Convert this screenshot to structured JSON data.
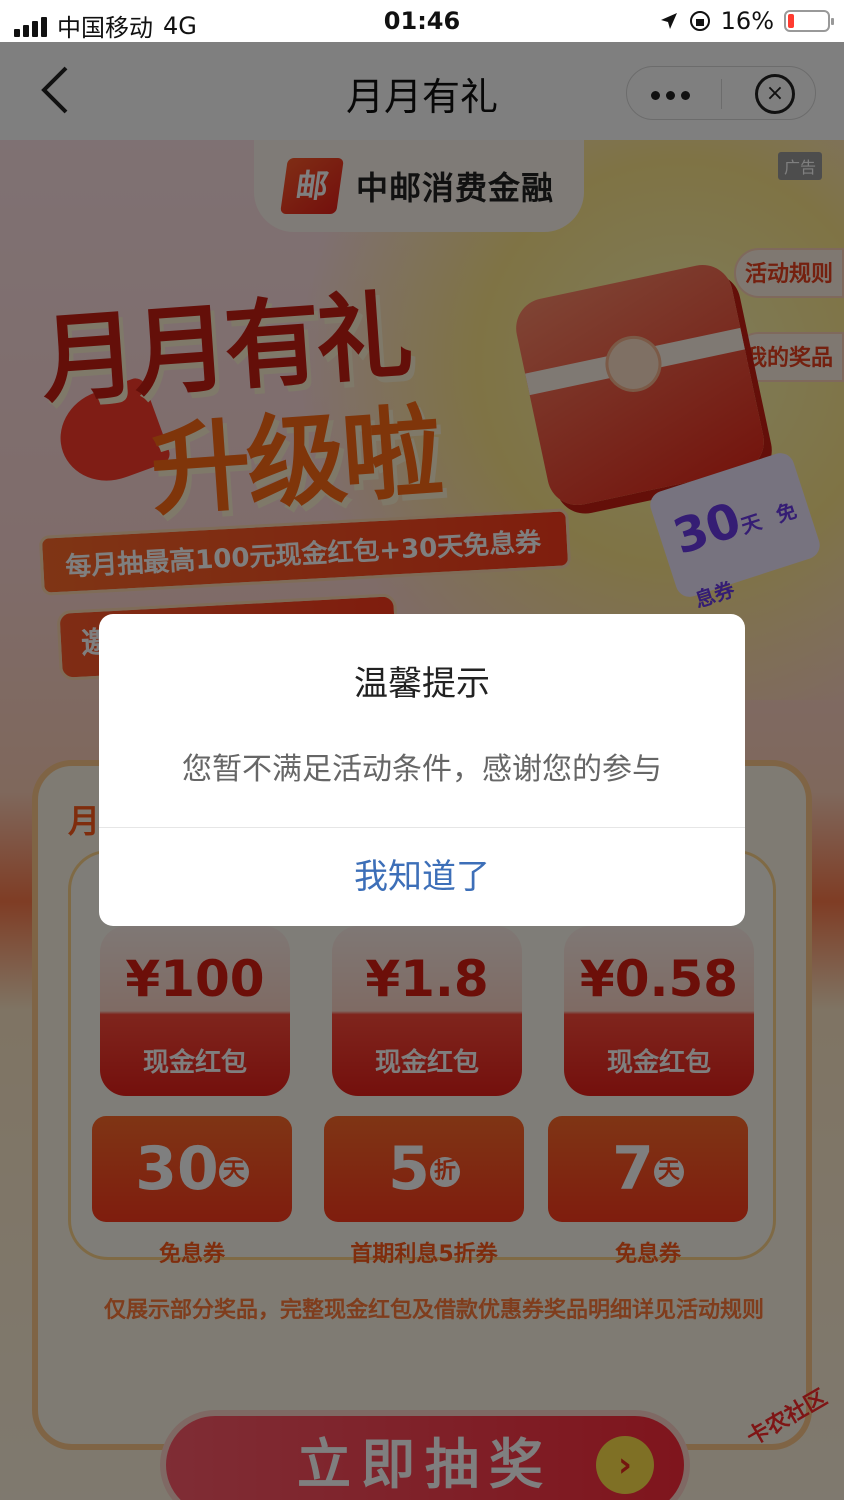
{
  "status_bar": {
    "carrier": "中国移动",
    "network": "4G",
    "time": "01:46",
    "battery": "16%",
    "battery_level": 0.16
  },
  "nav": {
    "title": "月月有礼"
  },
  "page": {
    "brand_name": "中邮消费金融",
    "ad_tag": "广告",
    "side_buttons": [
      "活动规则",
      "我的奖品"
    ],
    "hero_line1": "月月有礼",
    "hero_line2": "升级啦",
    "sub_banner": "每月抽最高100元现金红包+30天免息券",
    "ticket_value": "30",
    "ticket_unit": "天",
    "ticket_label": "免息券",
    "invite_text": "邀",
    "prize_card_title": "月",
    "cash_prizes": [
      {
        "amount": "¥100",
        "label": "现金红包"
      },
      {
        "amount": "¥1.8",
        "label": "现金红包"
      },
      {
        "amount": "¥0.58",
        "label": "现金红包"
      }
    ],
    "coupons": [
      {
        "value": "30",
        "unit": "天",
        "label": "免息券"
      },
      {
        "value": "5",
        "unit": "折",
        "label": "首期利息5折券"
      },
      {
        "value": "7",
        "unit": "天",
        "label": "免息券"
      }
    ],
    "prize_note": "仅展示部分奖品，完整现金红包及借款优惠券奖品明细详见活动规则",
    "draw_button": "立即抽奖",
    "watermark": "卡农社区"
  },
  "dialog": {
    "title": "温馨提示",
    "message": "您暂不满足活动条件，感谢您的参与",
    "confirm": "我知道了"
  },
  "colors": {
    "dialog_button": "#3d6fb8",
    "battery_low": "#ff3b30",
    "accent": "#ff4a1c"
  }
}
